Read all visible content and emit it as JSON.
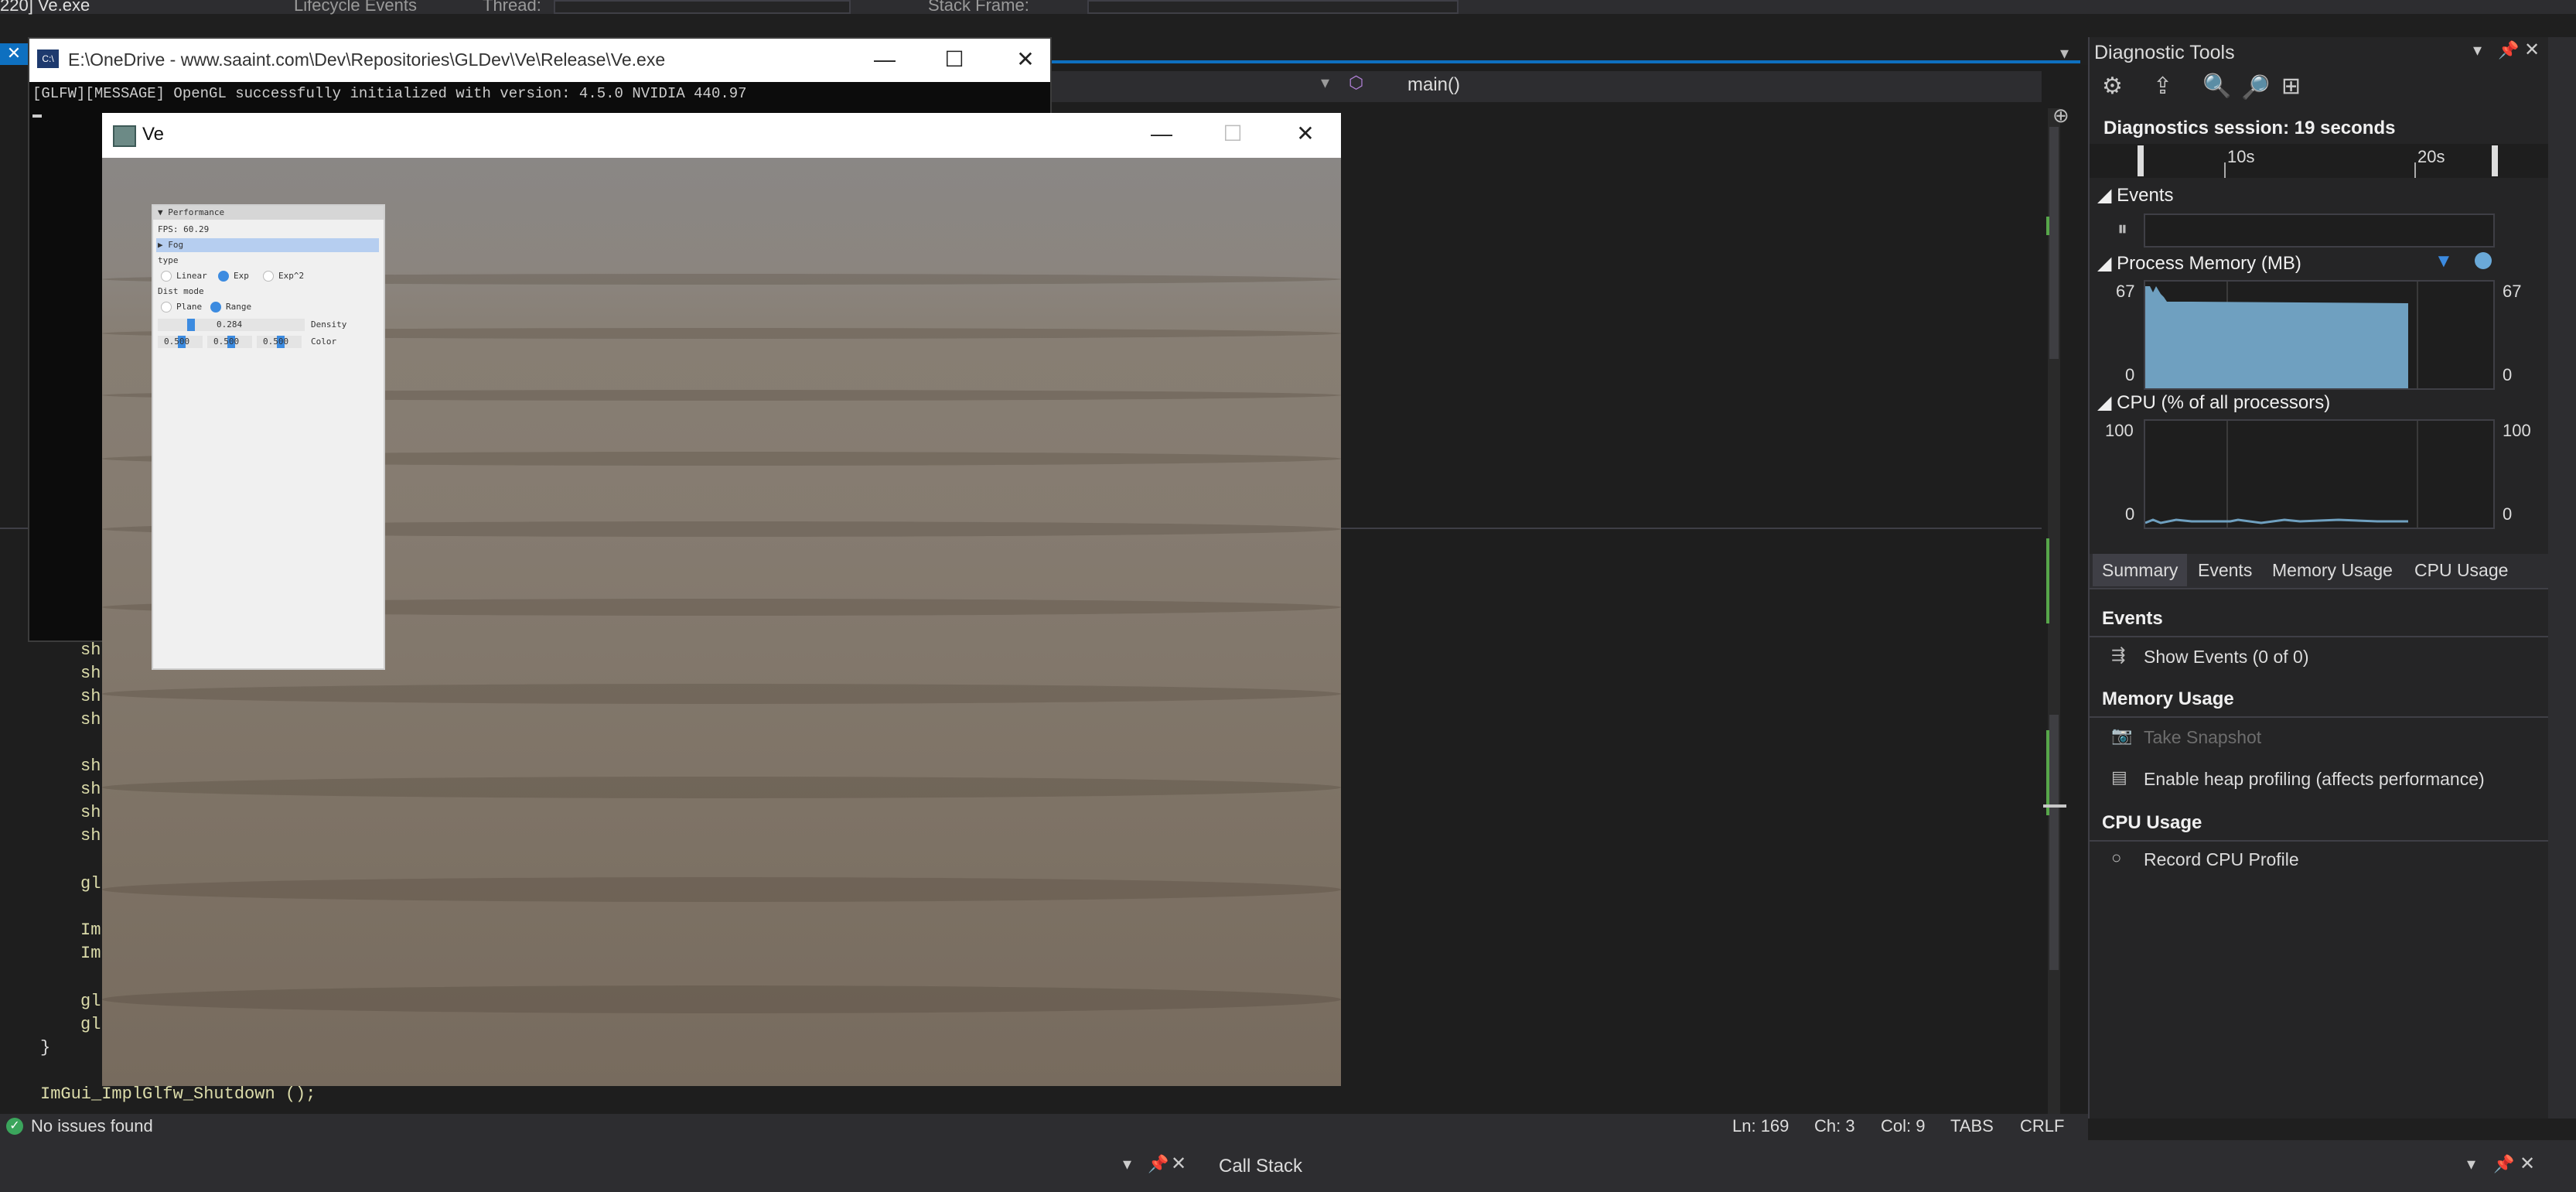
{
  "topbar": {
    "process": "220] Ve.exe",
    "lifecycle_label": "Lifecycle Events",
    "thread_label": "Thread:",
    "stack_frame_label": "Stack Frame:"
  },
  "editor": {
    "nav_function": "main()",
    "lines": [
      {
        "text": "sh"
      },
      {
        "text": "sh"
      },
      {
        "text": "sh"
      },
      {
        "text": "sh"
      },
      {
        "text": "sh"
      },
      {
        "text": "sh"
      },
      {
        "text": "sh"
      },
      {
        "text": "sh"
      },
      {
        "text": "gl"
      },
      {
        "text": "Im"
      },
      {
        "text": "Im"
      },
      {
        "text": "gl"
      },
      {
        "text": "gl"
      },
      {
        "text": "}"
      },
      {
        "text": "ImGui_ImplGlfw_Shutdown ();"
      }
    ]
  },
  "console": {
    "icon": "C:\\",
    "title": "E:\\OneDrive - www.saaint.com\\Dev\\Repositories\\GLDev\\Ve\\Release\\Ve.exe",
    "output": "[GLFW][MESSAGE] OpenGL successfully initialized with version: 4.5.0 NVIDIA 440.97",
    "minimize": "—",
    "maximize": "☐",
    "close": "✕"
  },
  "ve_window": {
    "title": "Ve",
    "minimize": "—",
    "maximize": "☐",
    "close": "✕"
  },
  "imgui": {
    "header": "▼ Performance",
    "fps": "FPS: 60.29",
    "fog": "▶ Fog",
    "type_label": "type",
    "type_options": [
      "Linear",
      "Exp",
      "Exp^2"
    ],
    "type_selected": "Exp",
    "dist_mode_label": "Dist mode",
    "dist_options": [
      "Plane",
      "Range"
    ],
    "dist_selected": "Range",
    "density_value": "0.284",
    "density_label": "Density",
    "color_values": [
      "0.500",
      "0.500",
      "0.500"
    ],
    "color_label": "Color"
  },
  "diagnostic": {
    "title": "Diagnostic Tools",
    "session": "Diagnostics session: 19 seconds",
    "timeline_ticks": [
      "10s",
      "20s"
    ],
    "events_header": "◢ Events",
    "memory_header": "◢ Process Memory (MB)",
    "memory_max": "67",
    "memory_min": "0",
    "cpu_header": "◢ CPU (% of all processors)",
    "cpu_max": "100",
    "cpu_min": "0",
    "tabs": [
      "Summary",
      "Events",
      "Memory Usage",
      "CPU Usage"
    ],
    "active_tab": "Summary",
    "sections": {
      "events": "Events",
      "show_events": "Show Events (0 of 0)",
      "memory_usage": "Memory Usage",
      "take_snapshot": "Take Snapshot",
      "enable_heap": "Enable heap profiling (affects performance)",
      "cpu_usage": "CPU Usage",
      "record_cpu": "Record CPU Profile"
    }
  },
  "status": {
    "issues": "No issues found",
    "ln": "Ln: 169",
    "ch": "Ch: 3",
    "col": "Col: 9",
    "tabs": "TABS",
    "eol": "CRLF"
  },
  "bottom": {
    "call_stack": "Call Stack"
  }
}
